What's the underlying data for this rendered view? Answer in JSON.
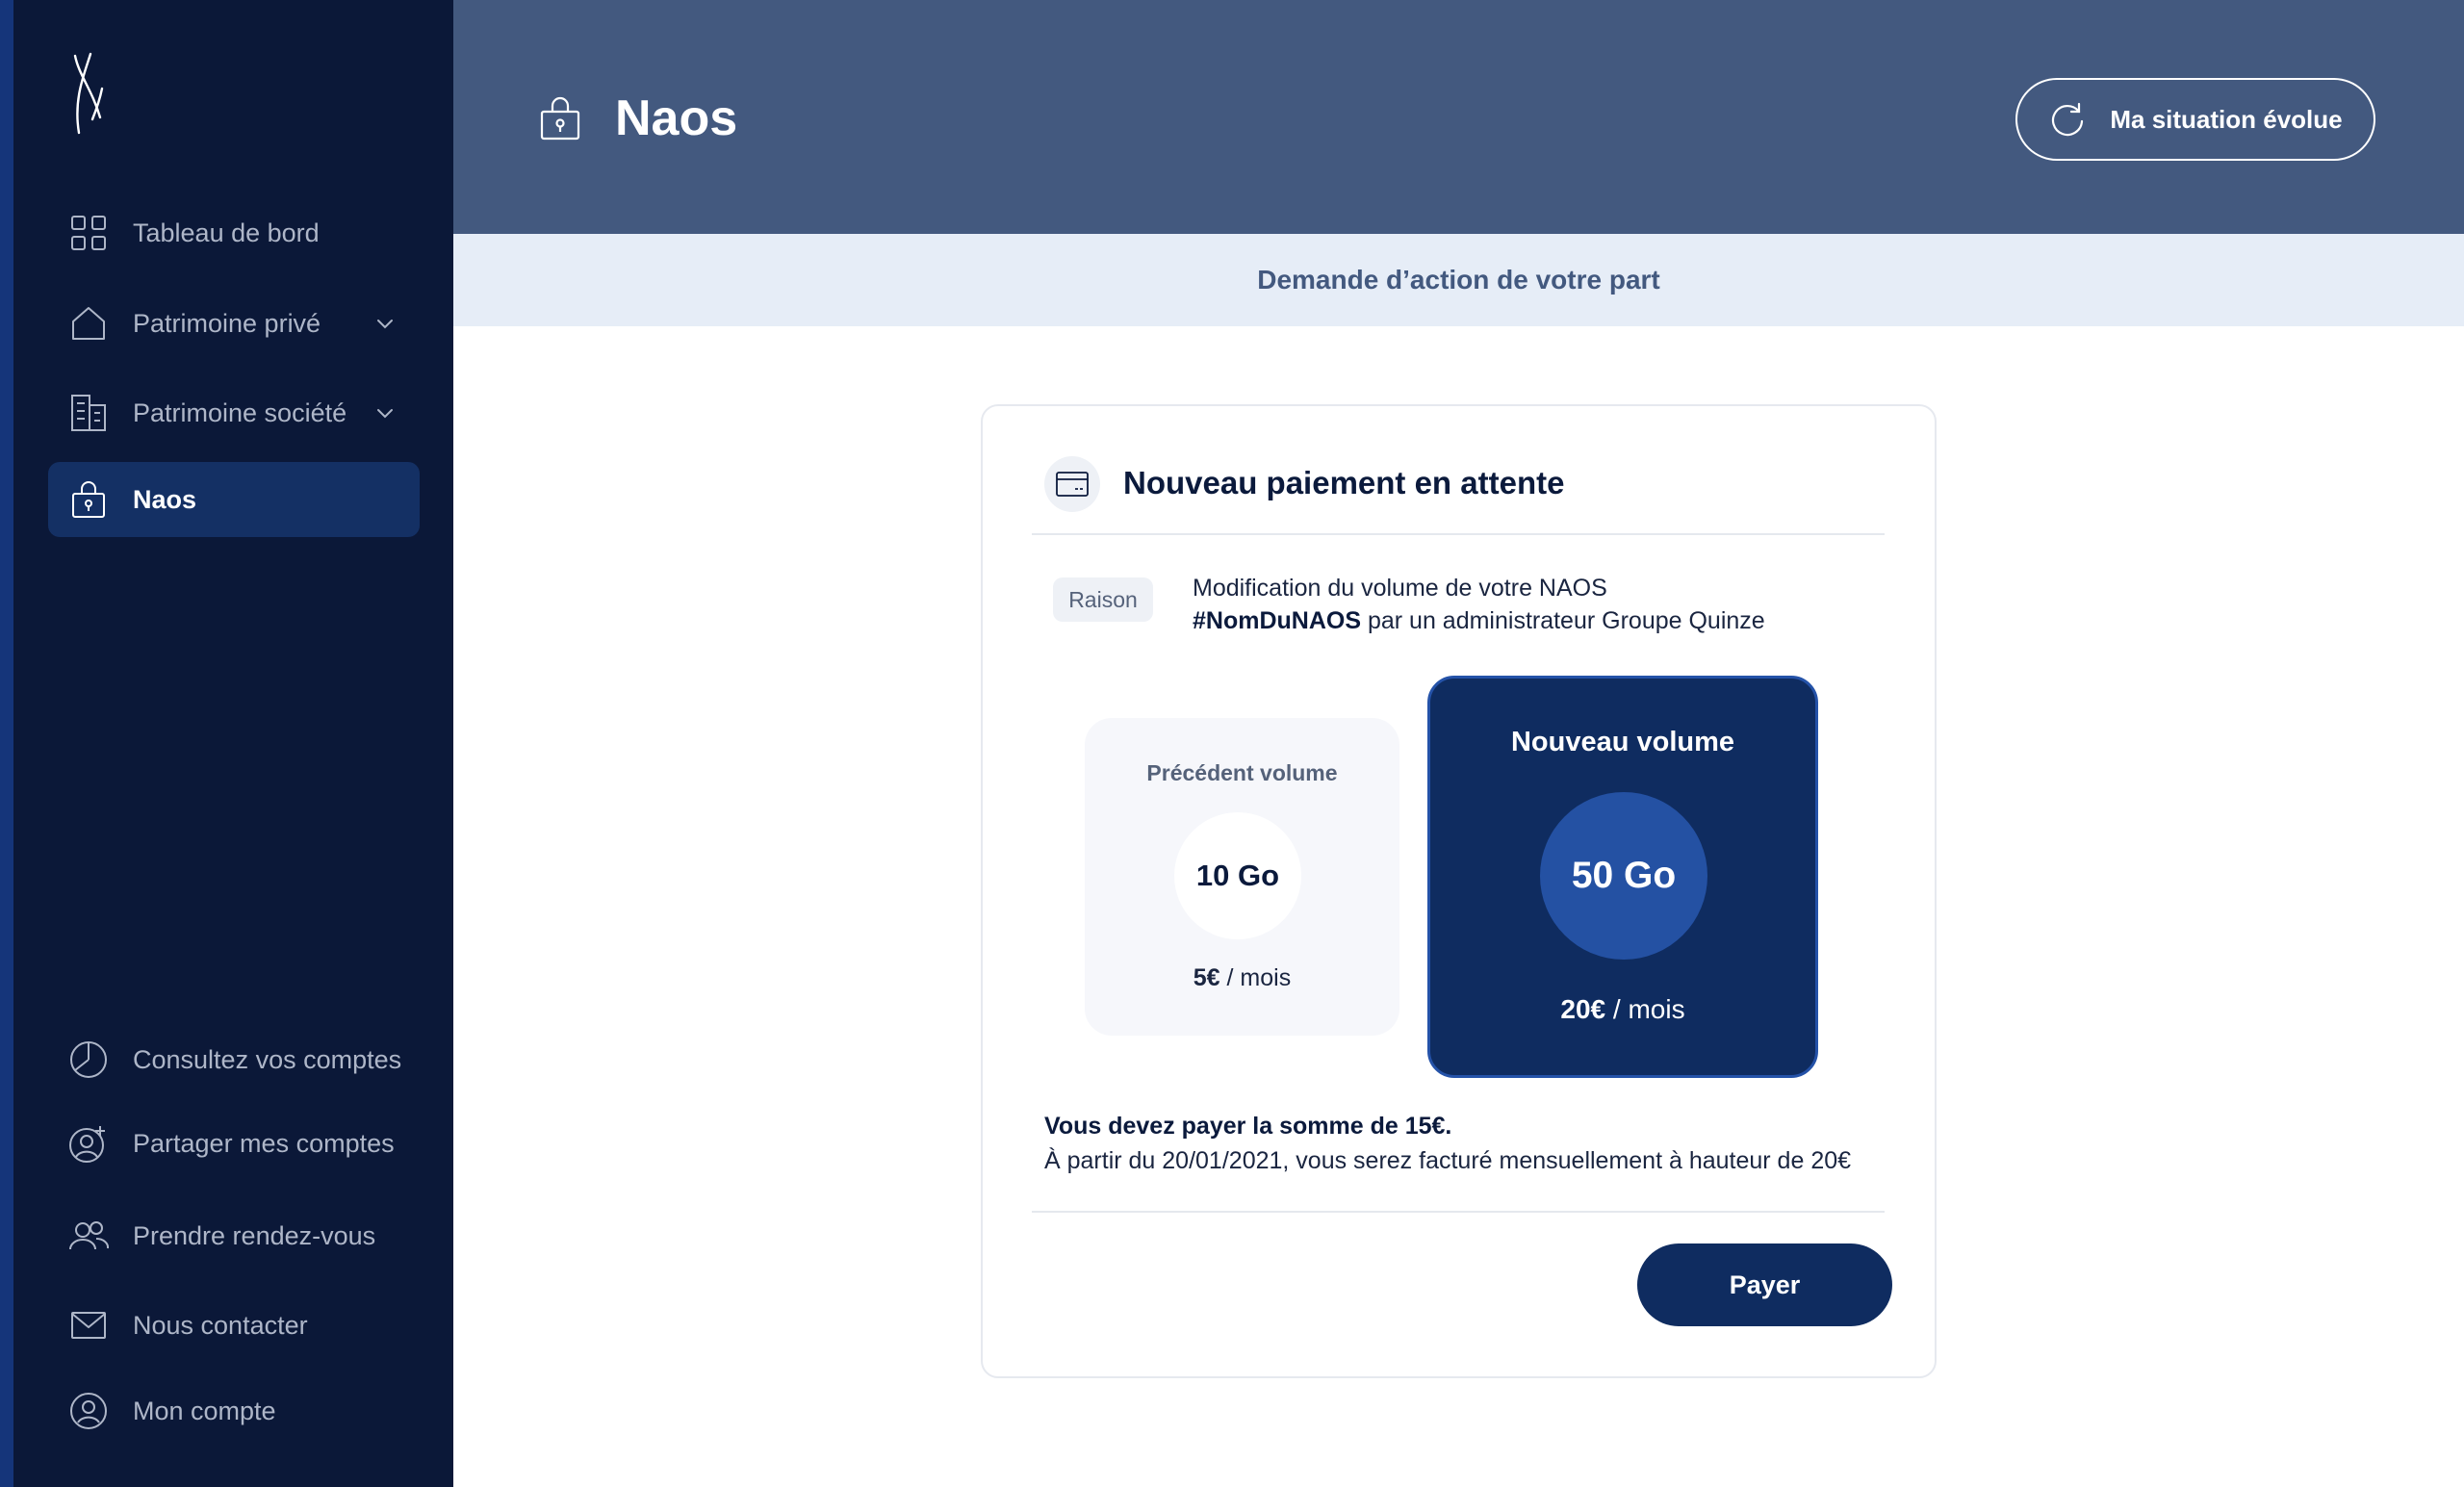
{
  "sidebar": {
    "main_items": [
      {
        "label": "Tableau de bord",
        "icon": "dashboard-grid-icon"
      },
      {
        "label": "Patrimoine privé",
        "icon": "home-icon",
        "expandable": true
      },
      {
        "label": "Patrimoine société",
        "icon": "building-icon",
        "expandable": true
      },
      {
        "label": "Naos",
        "icon": "lock-bag-icon",
        "active": true
      }
    ],
    "bottom_items": [
      {
        "label": "Consultez vos comptes",
        "icon": "pie-chart-icon"
      },
      {
        "label": "Partager mes comptes",
        "icon": "user-add-icon"
      },
      {
        "label": "Prendre rendez-vous",
        "icon": "users-icon"
      },
      {
        "label": "Nous contacter",
        "icon": "mail-icon"
      },
      {
        "label": "Mon compte",
        "icon": "user-circle-icon"
      }
    ]
  },
  "header": {
    "title": "Naos",
    "action_label": "Ma situation évolue"
  },
  "banner": {
    "text": "Demande d’action de votre part"
  },
  "card": {
    "title": "Nouveau paiement en attente",
    "reason_label": "Raison",
    "reason_line1": "Modification du volume de votre NAOS",
    "reason_name": "#NomDuNAOS",
    "reason_line2_rest": " par un administrateur Groupe Quinze",
    "previous": {
      "label": "Précédent volume",
      "volume": "10 Go",
      "price": "5€",
      "period": " / mois"
    },
    "new": {
      "label": "Nouveau volume",
      "volume": "50 Go",
      "price": "20€",
      "period": " / mois"
    },
    "payment_sum": "Vous devez payer la somme de 15€.",
    "payment_info": "À partir du 20/01/2021, vous serez facturé mensuellement à hauteur de 20€",
    "pay_label": "Payer"
  },
  "colors": {
    "sidebar_bg": "#0b1838",
    "header_bg": "#43597f",
    "banner_bg": "#e6edf7",
    "accent": "#0f2c60",
    "accent_light": "#2451a3"
  }
}
